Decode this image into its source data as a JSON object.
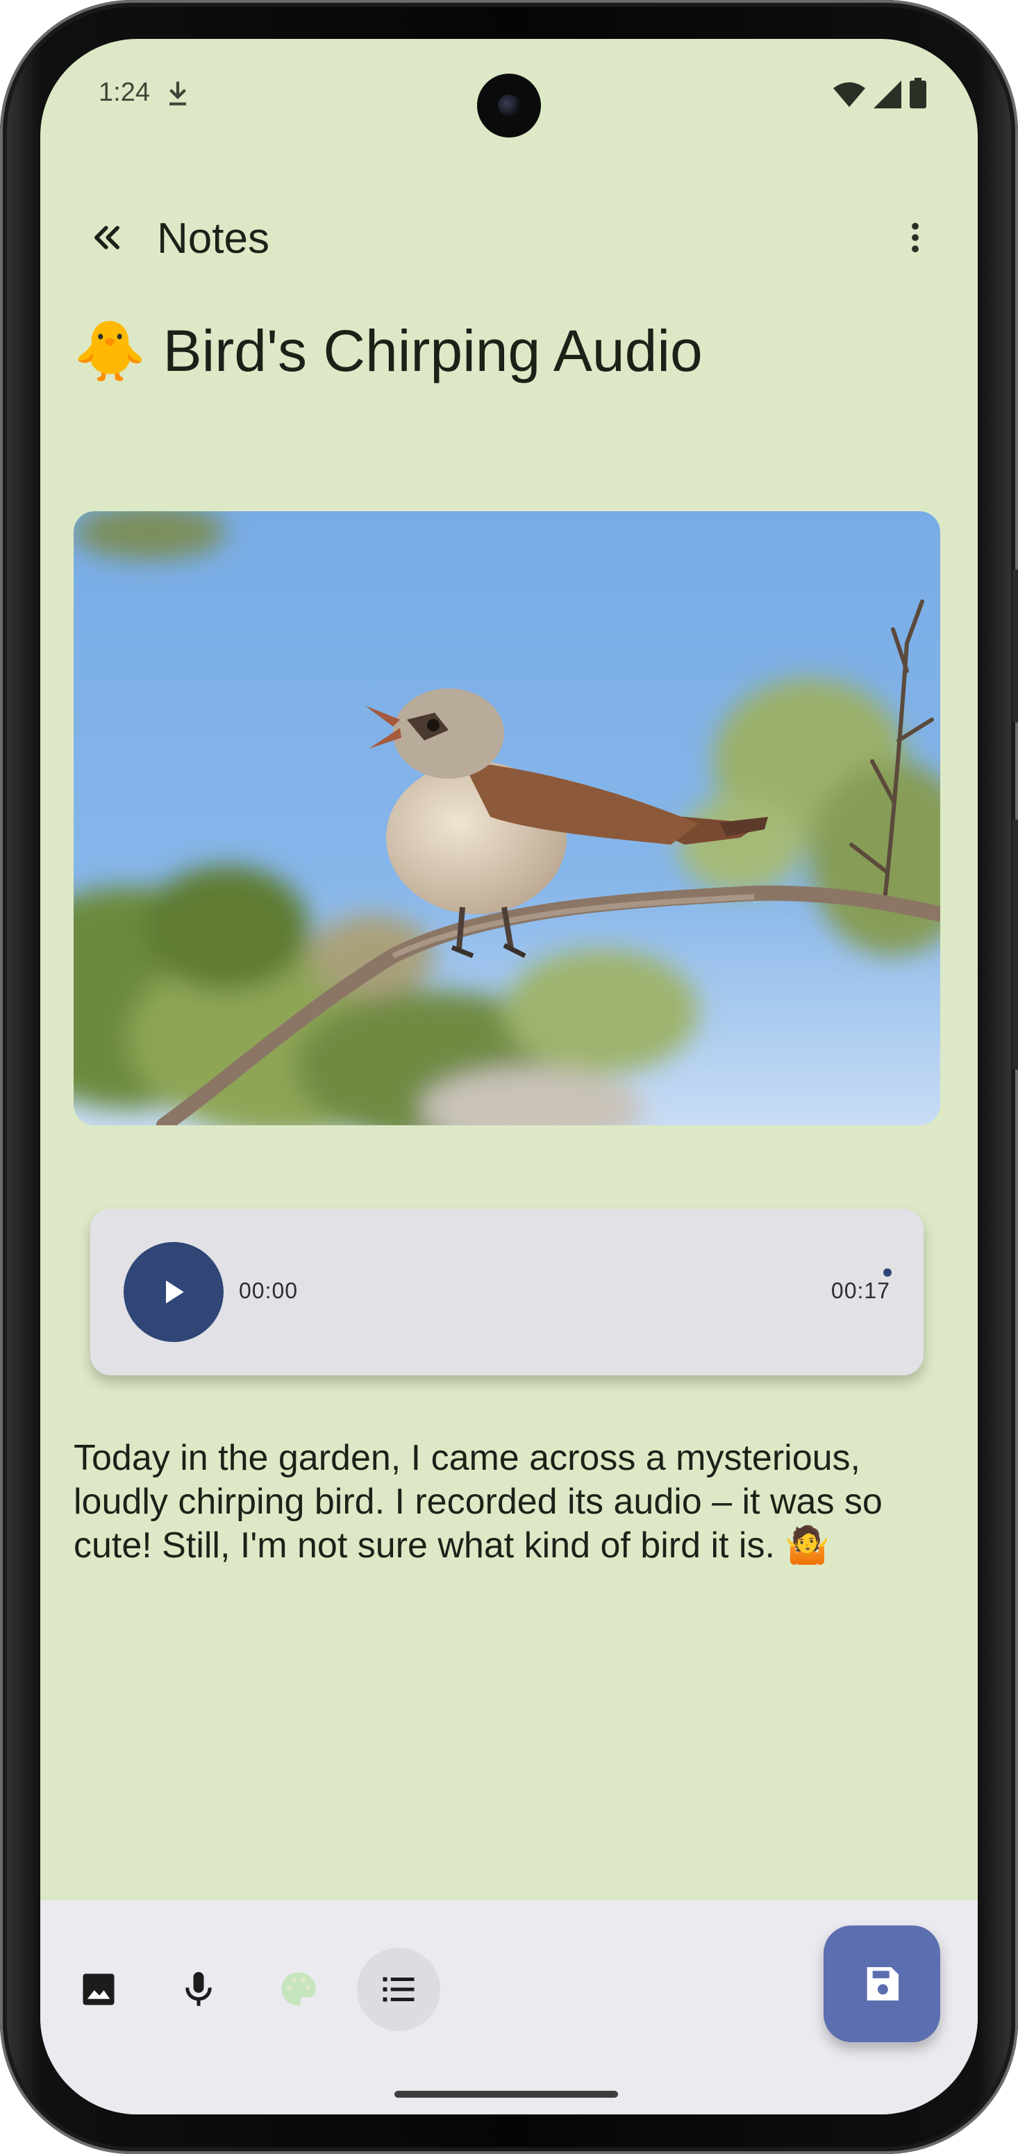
{
  "status_bar": {
    "time": "1:24",
    "icons": [
      "download-icon",
      "wifi-icon",
      "signal-icon",
      "battery-icon"
    ]
  },
  "app_bar": {
    "title": "Notes",
    "back_icon": "double-chevron-left-icon",
    "menu_icon": "more-vert-icon"
  },
  "note": {
    "title_emoji": "🐥",
    "title": "Bird's Chirping Audio",
    "image_icon": "bird-photo",
    "audio": {
      "current_time": "00:00",
      "total_time": "00:17",
      "progress": 0
    },
    "body": "Today in the garden, I came across  a mysterious, loudly chirping bird. I recorded its audio – it was so cute! Still, I'm not sure what kind of bird it is. 🤷"
  },
  "toolbar": {
    "items": [
      {
        "icon": "image-icon",
        "active": false
      },
      {
        "icon": "mic-icon",
        "active": false
      },
      {
        "icon": "palette-icon",
        "active": false
      },
      {
        "icon": "list-icon",
        "active": true
      }
    ],
    "fab_icon": "save-icon"
  },
  "colors": {
    "background": "#dde9c6",
    "bottom_bar": "#ebeaf0",
    "accent": "#2f4677",
    "fab": "#5b6eaf"
  }
}
